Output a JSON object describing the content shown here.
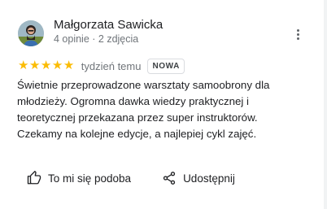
{
  "reviewer": {
    "name": "Małgorzata Sawicka",
    "meta": "4 opinie · 2 zdjęcia"
  },
  "rating": {
    "stars": 5,
    "max": 5,
    "time": "tydzień temu",
    "badge": "NOWA"
  },
  "review": {
    "lines": [
      "Świetnie przeprowadzone warsztaty samoobrony dla",
      "młodzieży. Ogromna dawka wiedzy praktycznej i",
      "teoretycznej przekazana przez super instruktorów.",
      "Czekamy na kolejne edycje, a najlepiej cykl zajęć."
    ]
  },
  "actions": {
    "like_label": "To mi się podoba",
    "share_label": "Udostępnij"
  },
  "colors": {
    "star": "#fbbc04",
    "text": "#202124",
    "secondary": "#70757a"
  }
}
